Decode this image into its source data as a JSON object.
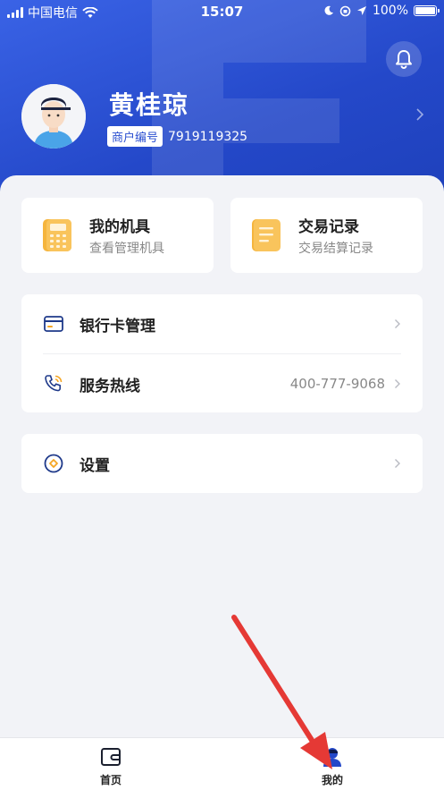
{
  "status_bar": {
    "carrier": "中国电信",
    "time": "15:07",
    "battery": "100%"
  },
  "profile": {
    "name": "黄桂琼",
    "merchant_label": "商户编号",
    "merchant_no": "7919119325"
  },
  "quick_actions": [
    {
      "title": "我的机具",
      "subtitle": "查看管理机具",
      "icon": "pos-terminal-icon"
    },
    {
      "title": "交易记录",
      "subtitle": "交易结算记录",
      "icon": "document-icon"
    }
  ],
  "menu": {
    "bank_card": {
      "label": "银行卡管理",
      "icon": "bank-card-icon"
    },
    "hotline": {
      "label": "服务热线",
      "value": "400-777-9068",
      "icon": "phone-icon"
    },
    "settings": {
      "label": "设置",
      "icon": "settings-icon"
    }
  },
  "tabbar": {
    "home": {
      "label": "首页",
      "icon": "wallet-icon"
    },
    "mine": {
      "label": "我的",
      "icon": "user-icon",
      "active": true
    }
  },
  "colors": {
    "brand_blue": "#2448c9",
    "accent_orange": "#f5b53d",
    "annotation_red": "#e53935"
  }
}
